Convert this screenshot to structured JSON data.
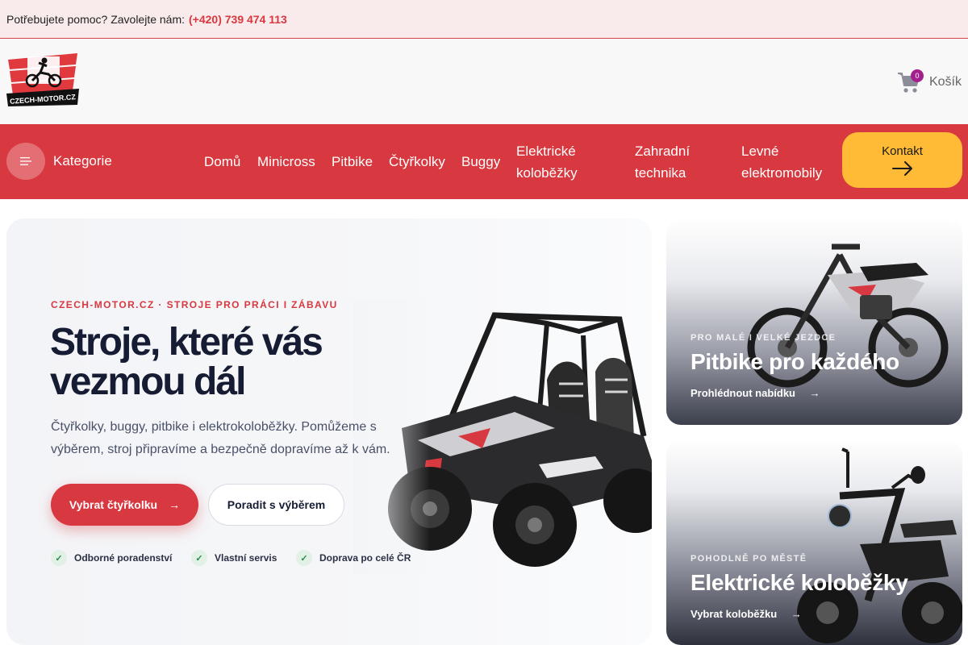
{
  "topbar": {
    "help_text": "Potřebujete pomoc? Zavolejte nám:",
    "phone": "(+420) 739 474 113"
  },
  "header": {
    "logo_text": "CZECH-MOTOR.CZ",
    "cart": {
      "label": "Košík",
      "count": "0"
    }
  },
  "nav": {
    "categories_label": "Kategorie",
    "items": [
      {
        "label": "Domů"
      },
      {
        "label": "Minicross"
      },
      {
        "label": "Pitbike"
      },
      {
        "label": "Čtyřkolky"
      },
      {
        "label": "Buggy"
      },
      {
        "label": "Elektrické koloběžky"
      },
      {
        "label": "Zahradní technika"
      },
      {
        "label": "Levné elektromobily"
      }
    ],
    "contact_label": "Kontakt"
  },
  "hero": {
    "eyebrow": "CZECH-MOTOR.CZ · STROJE PRO PRÁCI I ZÁBAVU",
    "title": "Stroje, které vás vezmou dál",
    "text": "Čtyřkolky, buggy, pitbike i elektrokoloběžky. Pomůžeme s výběrem, stroj připravíme a bezpečně dopravíme až k vám.",
    "primary_button": "Vybrat čtyřkolku",
    "secondary_button": "Poradit s výběrem",
    "usps": [
      {
        "label": "Odborné poradenství"
      },
      {
        "label": "Vlastní servis"
      },
      {
        "label": "Doprava po celé ČR"
      }
    ]
  },
  "cards": [
    {
      "eyebrow": "PRO MALÉ I VELKÉ JEZDCE",
      "title": "Pitbike pro každého",
      "link": "Prohlédnout nabídku"
    },
    {
      "eyebrow": "POHODLNĚ PO MĚSTĚ",
      "title": "Elektrické koloběžky",
      "link": "Vybrat koloběžku"
    }
  ],
  "icons": {
    "arrow": "→",
    "check": "✓",
    "menu": "menu-icon",
    "cart": "cart-icon"
  },
  "colors": {
    "brand_red": "#d8383f",
    "accent_yellow": "#ffbb35",
    "badge_purple": "#a41f8e",
    "topbar_bg": "#f9ebeb"
  }
}
